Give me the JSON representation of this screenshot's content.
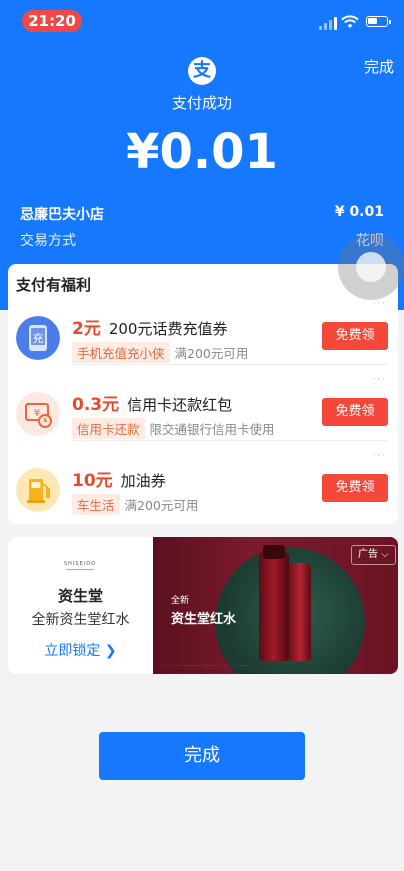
{
  "status_bar": {
    "time": "21:20"
  },
  "header": {
    "done_label": "完成",
    "logo_char": "支",
    "status_text": "支付成功",
    "amount": "¥0.01"
  },
  "details": {
    "merchant_name": "忌廉巴夫小店",
    "merchant_amount": "¥ 0.01",
    "method_label": "交易方式",
    "method_value": "花呗"
  },
  "benefits": {
    "title": "支付有福利",
    "more_glyph": "···",
    "items": [
      {
        "price": "2元",
        "name": "200元话费充值券",
        "tag": "手机充值充小侠",
        "desc": "满200元可用",
        "button": "免费领",
        "icon": "phone-recharge-icon"
      },
      {
        "price": "0.3元",
        "name": "信用卡还款红包",
        "tag": "信用卡还款",
        "desc": "限交通银行信用卡使用",
        "button": "免费领",
        "icon": "credit-card-repay-icon"
      },
      {
        "price": "10元",
        "name": "加油券",
        "tag": "车生活",
        "desc": "满200元可用",
        "button": "免费领",
        "icon": "fuel-pump-icon"
      }
    ]
  },
  "ad": {
    "brand_mark": "SHISEIDO",
    "brand_name": "资生堂",
    "product": "全新资生堂红水",
    "cta": "立即锁定 ❯",
    "badge": "广告 ⌵",
    "banner_line1": "全新",
    "banner_line2": "资生堂红水"
  },
  "footer": {
    "done_label": "完成"
  },
  "colors": {
    "brand_blue": "#1677ff",
    "claim_red": "#f5483a",
    "price_red": "#e9482b"
  }
}
